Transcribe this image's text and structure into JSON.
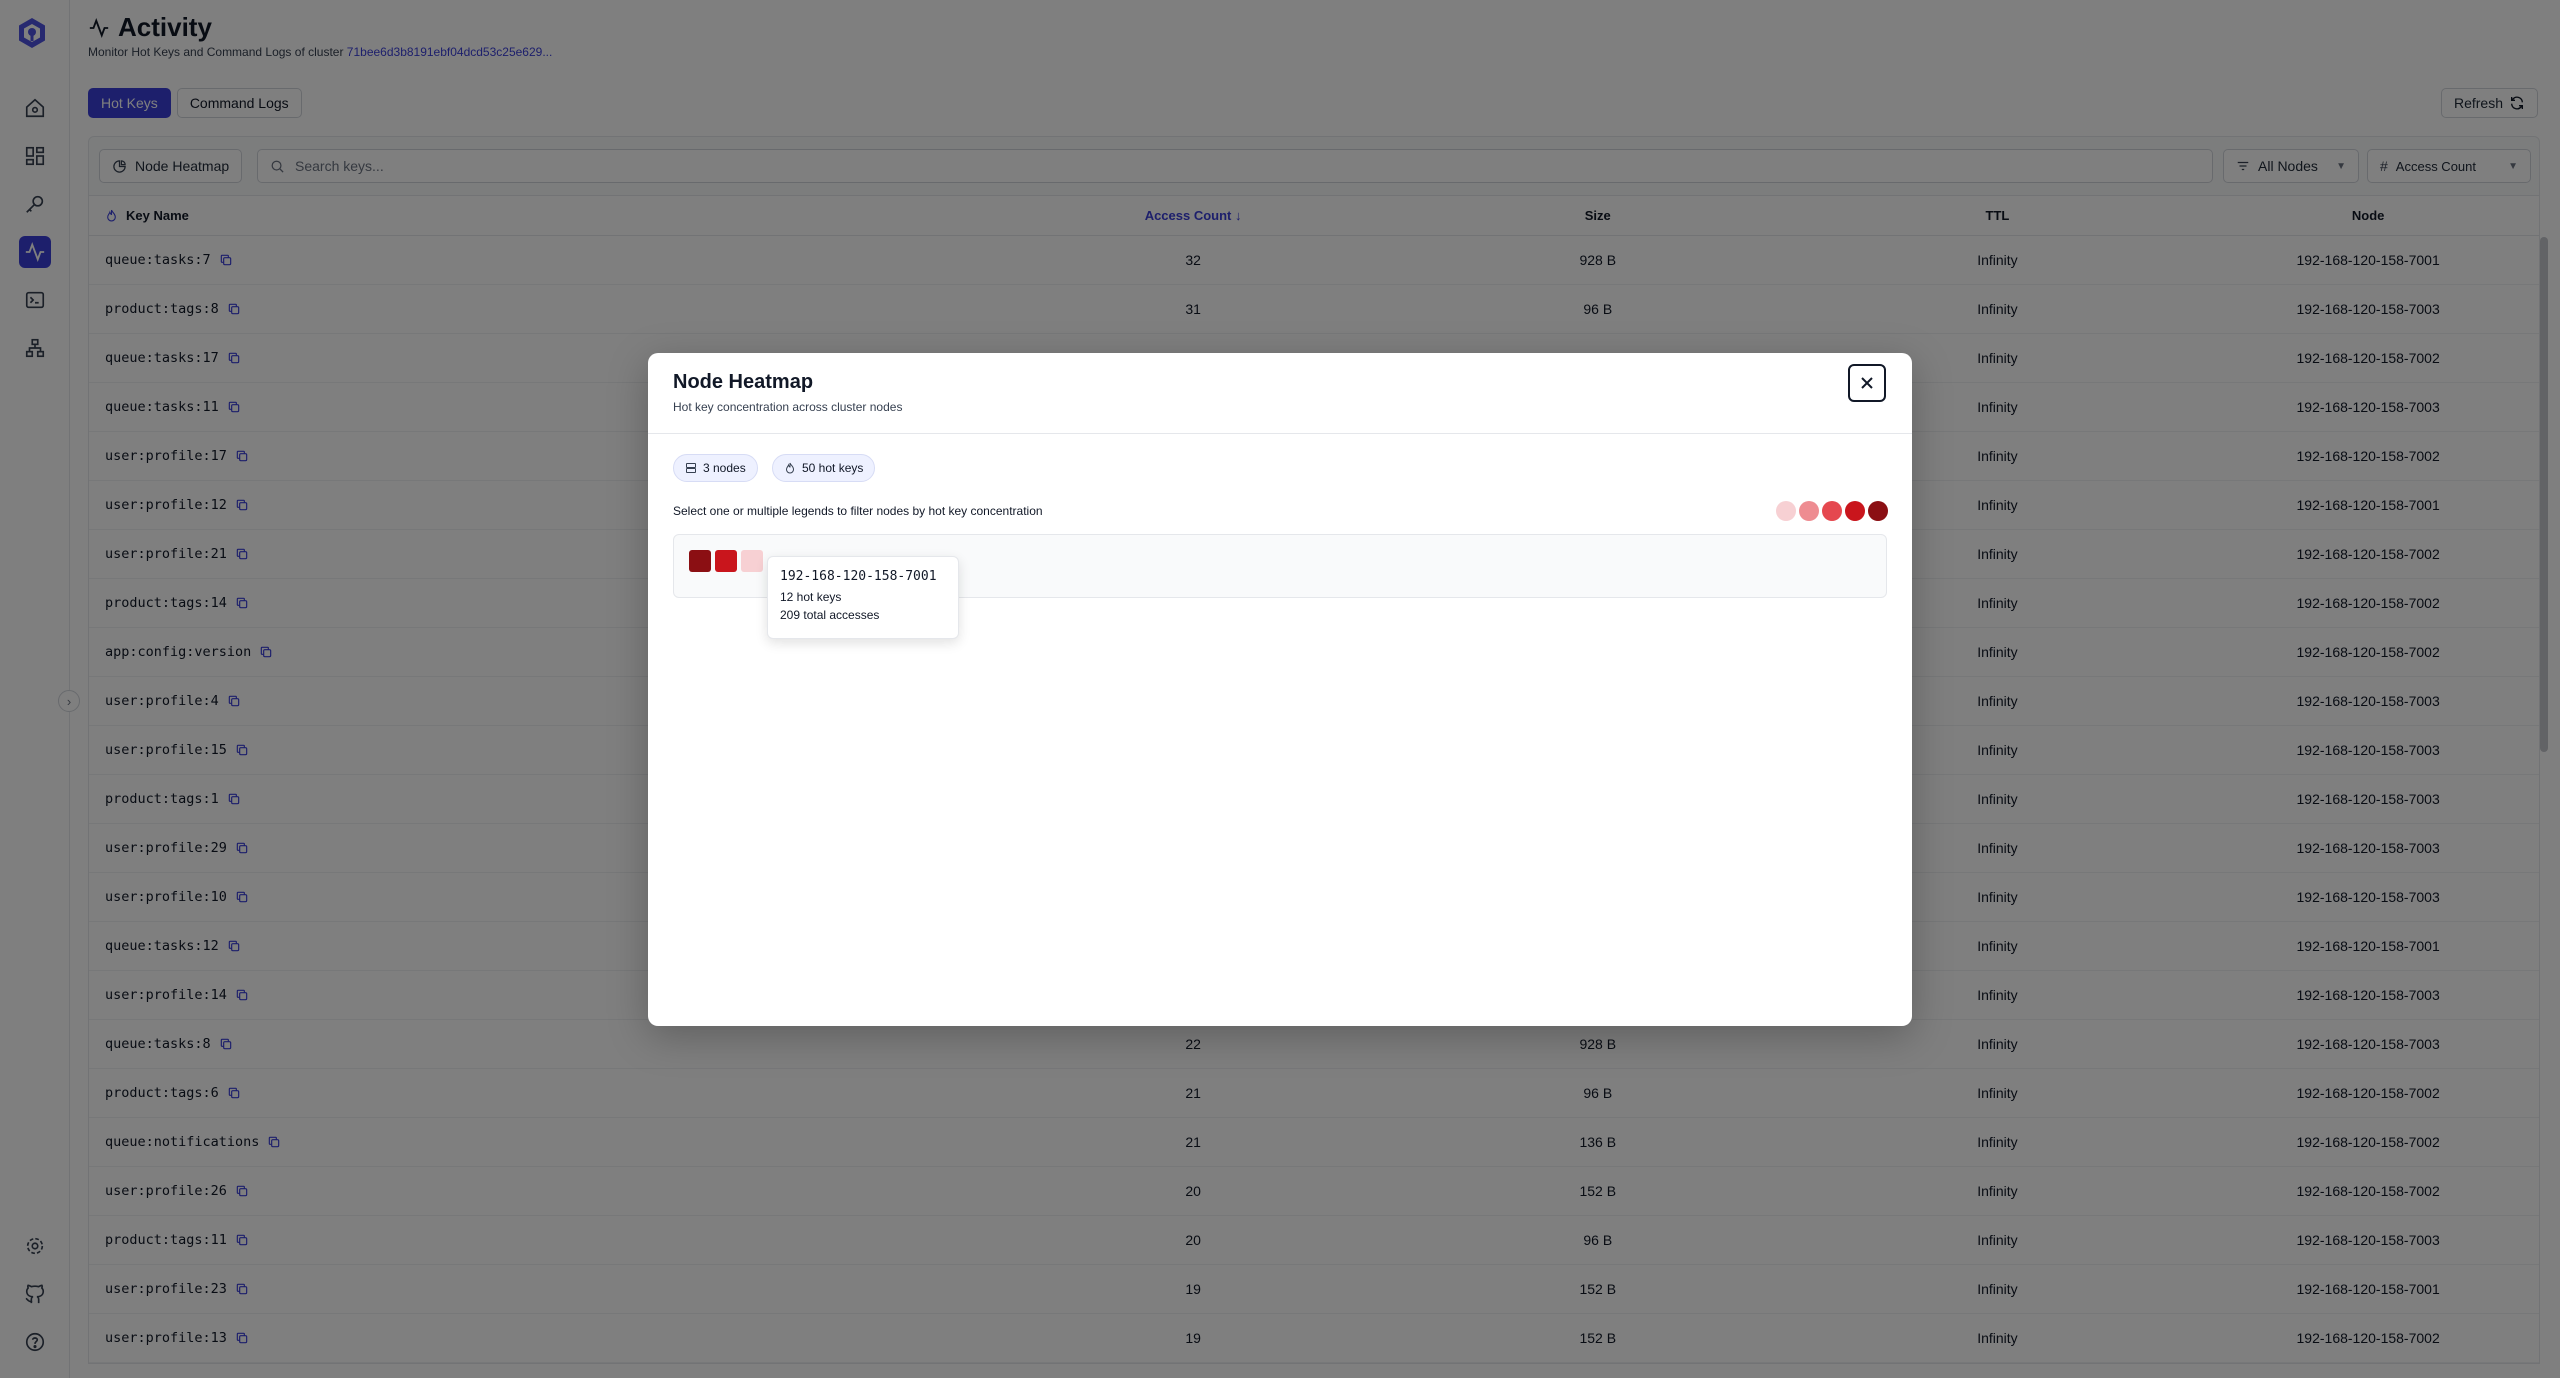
{
  "header": {
    "title": "Activity",
    "subtitle_prefix": "Monitor Hot Keys and Command Logs of cluster",
    "cluster_id": "71bee6d3b8191ebf04dcd53c25e629..."
  },
  "tabs": [
    {
      "label": "Hot Keys",
      "active": true
    },
    {
      "label": "Command Logs",
      "active": false
    }
  ],
  "refresh_label": "Refresh",
  "toolbar": {
    "heatmap_label": "Node Heatmap",
    "search_placeholder": "Search keys...",
    "nodes_filter": "All Nodes",
    "sort_by": "Access Count"
  },
  "table": {
    "columns": {
      "key": "Key Name",
      "count": "Access Count",
      "size": "Size",
      "ttl": "TTL",
      "node": "Node"
    },
    "rows": [
      {
        "key": "queue:tasks:7",
        "count": "32",
        "size": "928 B",
        "ttl": "Infinity",
        "node": "192-168-120-158-7001"
      },
      {
        "key": "product:tags:8",
        "count": "31",
        "size": "96 B",
        "ttl": "Infinity",
        "node": "192-168-120-158-7003"
      },
      {
        "key": "queue:tasks:17",
        "count": "",
        "size": "",
        "ttl": "Infinity",
        "node": "192-168-120-158-7002"
      },
      {
        "key": "queue:tasks:11",
        "count": "",
        "size": "",
        "ttl": "Infinity",
        "node": "192-168-120-158-7003"
      },
      {
        "key": "user:profile:17",
        "count": "",
        "size": "",
        "ttl": "Infinity",
        "node": "192-168-120-158-7002"
      },
      {
        "key": "user:profile:12",
        "count": "",
        "size": "",
        "ttl": "Infinity",
        "node": "192-168-120-158-7001"
      },
      {
        "key": "user:profile:21",
        "count": "",
        "size": "",
        "ttl": "Infinity",
        "node": "192-168-120-158-7002"
      },
      {
        "key": "product:tags:14",
        "count": "",
        "size": "",
        "ttl": "Infinity",
        "node": "192-168-120-158-7002"
      },
      {
        "key": "app:config:version",
        "count": "",
        "size": "",
        "ttl": "Infinity",
        "node": "192-168-120-158-7002"
      },
      {
        "key": "user:profile:4",
        "count": "",
        "size": "",
        "ttl": "Infinity",
        "node": "192-168-120-158-7003"
      },
      {
        "key": "user:profile:15",
        "count": "",
        "size": "",
        "ttl": "Infinity",
        "node": "192-168-120-158-7003"
      },
      {
        "key": "product:tags:1",
        "count": "",
        "size": "",
        "ttl": "Infinity",
        "node": "192-168-120-158-7003"
      },
      {
        "key": "user:profile:29",
        "count": "",
        "size": "",
        "ttl": "Infinity",
        "node": "192-168-120-158-7003"
      },
      {
        "key": "user:profile:10",
        "count": "",
        "size": "",
        "ttl": "Infinity",
        "node": "192-168-120-158-7003"
      },
      {
        "key": "queue:tasks:12",
        "count": "",
        "size": "",
        "ttl": "Infinity",
        "node": "192-168-120-158-7001"
      },
      {
        "key": "user:profile:14",
        "count": "",
        "size": "",
        "ttl": "Infinity",
        "node": "192-168-120-158-7003"
      },
      {
        "key": "queue:tasks:8",
        "count": "22",
        "size": "928 B",
        "ttl": "Infinity",
        "node": "192-168-120-158-7003"
      },
      {
        "key": "product:tags:6",
        "count": "21",
        "size": "96 B",
        "ttl": "Infinity",
        "node": "192-168-120-158-7002"
      },
      {
        "key": "queue:notifications",
        "count": "21",
        "size": "136 B",
        "ttl": "Infinity",
        "node": "192-168-120-158-7002"
      },
      {
        "key": "user:profile:26",
        "count": "20",
        "size": "152 B",
        "ttl": "Infinity",
        "node": "192-168-120-158-7002"
      },
      {
        "key": "product:tags:11",
        "count": "20",
        "size": "96 B",
        "ttl": "Infinity",
        "node": "192-168-120-158-7003"
      },
      {
        "key": "user:profile:23",
        "count": "19",
        "size": "152 B",
        "ttl": "Infinity",
        "node": "192-168-120-158-7001"
      },
      {
        "key": "user:profile:13",
        "count": "19",
        "size": "152 B",
        "ttl": "Infinity",
        "node": "192-168-120-158-7002"
      }
    ]
  },
  "modal": {
    "title": "Node Heatmap",
    "subtitle": "Hot key concentration across cluster nodes",
    "nodes_pill": "3 nodes",
    "hotkeys_pill": "50 hot keys",
    "legend_text": "Select one or multiple legends to filter nodes by hot key concentration",
    "legend_colors": [
      "#f7d0d3",
      "#ee8c91",
      "#e5484f",
      "#c9151c",
      "#8b0f13"
    ],
    "cells": [
      {
        "color": "#8b0f13"
      },
      {
        "color": "#c9151c"
      },
      {
        "color": "#f7d0d3"
      }
    ],
    "tooltip": {
      "node": "192-168-120-158-7001",
      "hot_keys": "12 hot keys",
      "accesses": "209 total accesses"
    }
  },
  "colors": {
    "accent": "#3b3fd8"
  }
}
